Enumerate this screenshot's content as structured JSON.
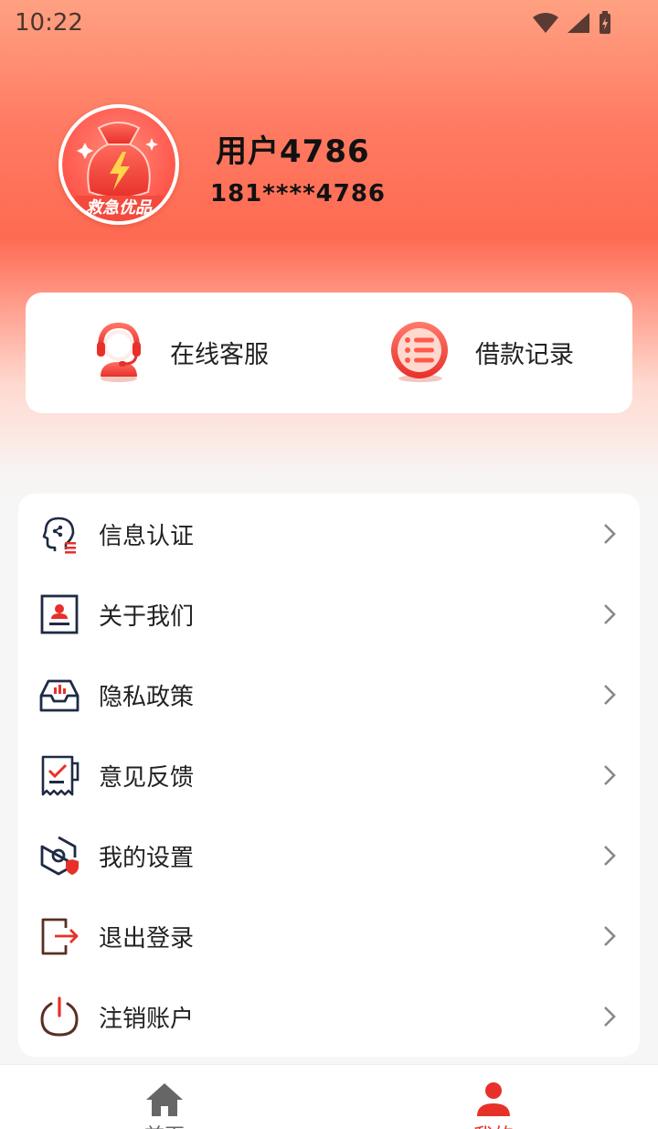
{
  "status_bar": {
    "time": "10:22"
  },
  "profile": {
    "avatar_badge_text": "救急优品",
    "name": "用户4786",
    "phone": "181****4786"
  },
  "quick_actions": [
    {
      "label": "在线客服",
      "icon": "customer-service-icon"
    },
    {
      "label": "借款记录",
      "icon": "loan-record-icon"
    }
  ],
  "menu": [
    {
      "label": "信息认证",
      "icon": "info-auth-icon"
    },
    {
      "label": "关于我们",
      "icon": "about-us-icon"
    },
    {
      "label": "隐私政策",
      "icon": "privacy-policy-icon"
    },
    {
      "label": "意见反馈",
      "icon": "feedback-icon"
    },
    {
      "label": "我的设置",
      "icon": "settings-icon"
    },
    {
      "label": "退出登录",
      "icon": "logout-icon"
    },
    {
      "label": "注销账户",
      "icon": "power-icon"
    }
  ],
  "tab_bar": {
    "tabs": [
      {
        "label": "首页",
        "icon": "home-icon",
        "active": false
      },
      {
        "label": "我的",
        "icon": "person-icon",
        "active": true
      }
    ]
  },
  "colors": {
    "accent": "#e8302a",
    "header_top": "#ffa182",
    "header_mid": "#ff6a52",
    "icon_navy": "#1f2a44"
  }
}
